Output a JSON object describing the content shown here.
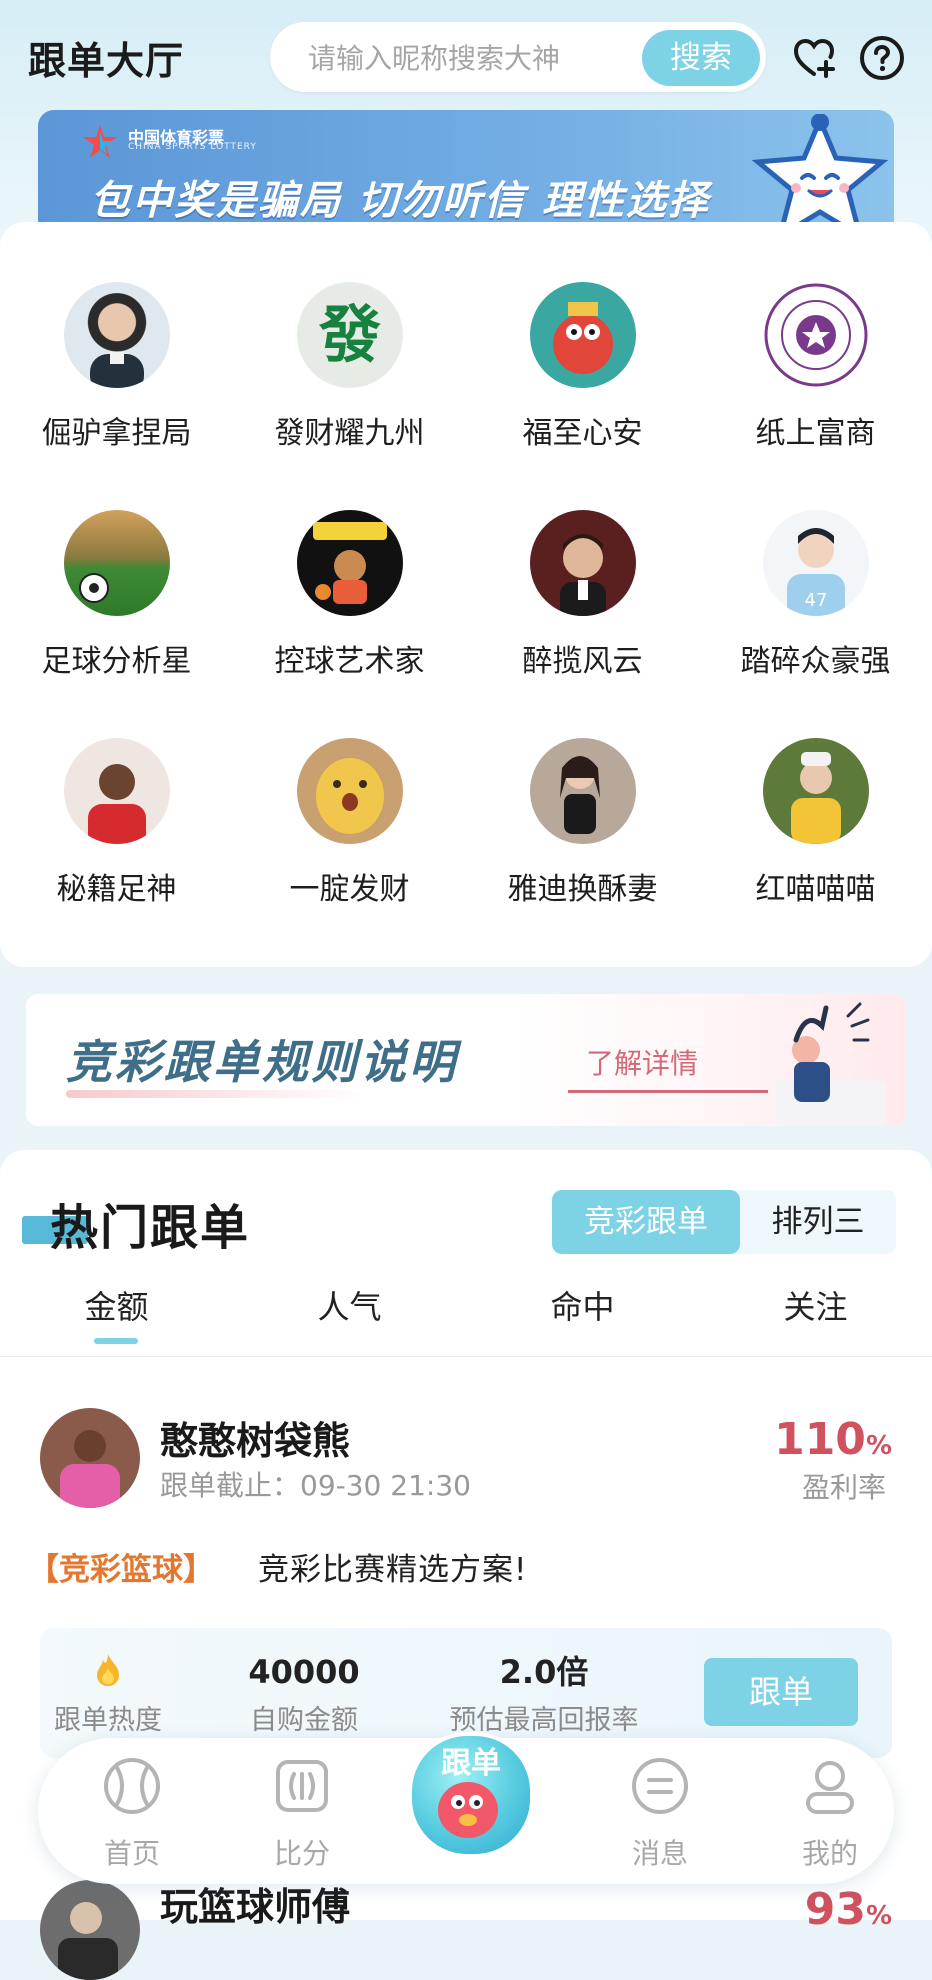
{
  "header": {
    "title": "跟单大厅",
    "search_placeholder": "请输入昵称搜索大神",
    "search_button": "搜索"
  },
  "banner": {
    "logo_text": "中国体育彩票",
    "logo_sub": "CHINA SPORTS LOTTERY",
    "text": "包中奖是骗局 切勿听信 理性选择"
  },
  "experts": [
    {
      "name": "倔驴拿捏局"
    },
    {
      "name": "發财耀九州"
    },
    {
      "name": "福至心安"
    },
    {
      "name": "纸上富商"
    },
    {
      "name": "足球分析星"
    },
    {
      "name": "控球艺术家"
    },
    {
      "name": "醉揽风云"
    },
    {
      "name": "踏碎众豪强"
    },
    {
      "name": "秘籍足神"
    },
    {
      "name": "一腚发财"
    },
    {
      "name": "雅迪换酥妻"
    },
    {
      "name": "红喵喵喵"
    }
  ],
  "rules": {
    "title": "竞彩跟单规则说明",
    "link": "了解详情"
  },
  "hot": {
    "title": "热门跟单",
    "seg_active": "竞彩跟单",
    "seg_other": "排列三",
    "tabs": [
      "金额",
      "人气",
      "命中",
      "关注"
    ]
  },
  "post": {
    "name": "憨憨树袋熊",
    "deadline": "跟单截止：09-30 21:30",
    "profit_value": "110",
    "profit_unit": "%",
    "profit_label": "盈利率",
    "tag": "【竞彩篮球】",
    "text": "竞彩比赛精选方案!",
    "stats": {
      "heat_label": "跟单热度",
      "amount": "40000",
      "amount_label": "自购金额",
      "ratio": "2.0倍",
      "ratio_label": "预估最高回报率"
    },
    "follow_button": "跟单"
  },
  "next_post": {
    "name": "玩篮球师傅",
    "profit_value": "93",
    "profit_unit": "%"
  },
  "nav": {
    "items": [
      {
        "label": "首页"
      },
      {
        "label": "比分"
      },
      {
        "label": "跟单"
      },
      {
        "label": "消息"
      },
      {
        "label": "我的"
      }
    ]
  },
  "colors": {
    "accent": "#7ed2e6",
    "profit": "#d0525f",
    "tag": "#e4772f"
  }
}
